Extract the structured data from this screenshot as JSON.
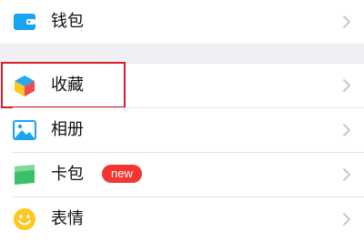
{
  "menu": {
    "wallet": {
      "label": "钱包",
      "icon": "wallet-icon"
    },
    "favorites": {
      "label": "收藏",
      "icon": "cube-icon"
    },
    "album": {
      "label": "相册",
      "icon": "photo-icon"
    },
    "cards": {
      "label": "卡包",
      "icon": "card-icon",
      "badge": "new"
    },
    "stickers": {
      "label": "表情",
      "icon": "smiley-icon"
    }
  },
  "colors": {
    "highlight": "#d81e2a",
    "badge": "#f43530",
    "accent_blue": "#1aa3f3",
    "section_gap": "#efeff4"
  }
}
